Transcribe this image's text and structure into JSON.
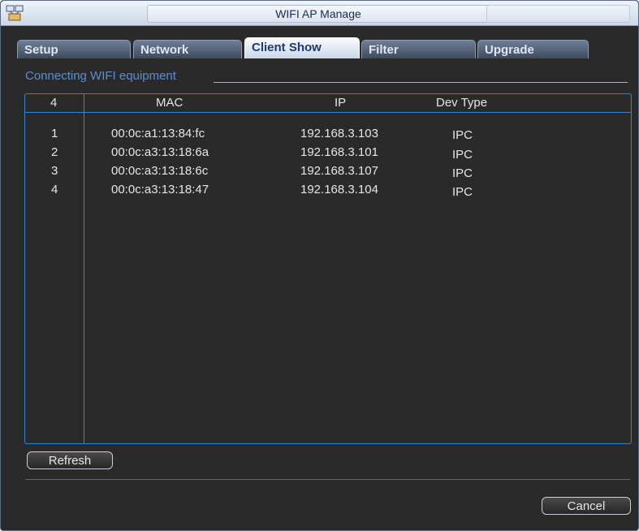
{
  "window": {
    "title": "WIFI AP Manage",
    "icon": "network-devices-icon"
  },
  "tabs": [
    {
      "label": "Setup"
    },
    {
      "label": "Network"
    },
    {
      "label": "Client Show",
      "active": true
    },
    {
      "label": "Filter"
    },
    {
      "label": "Upgrade"
    }
  ],
  "section": {
    "title": "Connecting WIFI equipment"
  },
  "table": {
    "columns": [
      "4",
      "MAC",
      "IP",
      "Dev Type"
    ],
    "rows": [
      {
        "no": "1",
        "mac": "00:0c:a1:13:84:fc",
        "ip": "192.168.3.103",
        "type": "IPC"
      },
      {
        "no": "2",
        "mac": "00:0c:a3:13:18:6a",
        "ip": "192.168.3.101",
        "type": "IPC"
      },
      {
        "no": "3",
        "mac": "00:0c:a3:13:18:6c",
        "ip": "192.168.3.107",
        "type": "IPC"
      },
      {
        "no": "4",
        "mac": "00:0c:a3:13:18:47",
        "ip": "192.168.3.104",
        "type": "IPC"
      }
    ]
  },
  "buttons": {
    "refresh": "Refresh",
    "cancel": "Cancel"
  },
  "colors": {
    "accent": "#3d7fd0",
    "section_text": "#5b8fd0",
    "background": "#2a2a2a"
  }
}
